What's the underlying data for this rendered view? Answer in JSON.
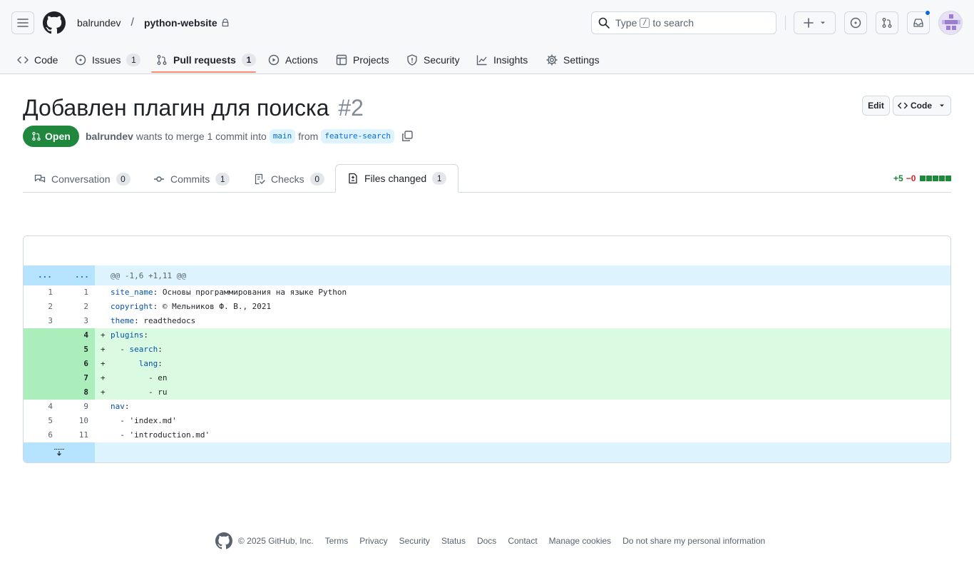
{
  "header": {
    "owner": "balrundev",
    "separator": "/",
    "repo": "python-website",
    "search": {
      "prefix": "Type",
      "key": "/",
      "suffix": "to search"
    }
  },
  "repo_nav": [
    {
      "label": "Code",
      "icon": "code-icon"
    },
    {
      "label": "Issues",
      "icon": "issue-opened-icon",
      "count": "1"
    },
    {
      "label": "Pull requests",
      "icon": "git-pull-request-icon",
      "count": "1",
      "active": true
    },
    {
      "label": "Actions",
      "icon": "play-icon"
    },
    {
      "label": "Projects",
      "icon": "table-icon"
    },
    {
      "label": "Security",
      "icon": "shield-icon"
    },
    {
      "label": "Insights",
      "icon": "graph-icon"
    },
    {
      "label": "Settings",
      "icon": "gear-icon"
    }
  ],
  "pr": {
    "title": "Добавлен плагин для поиска",
    "number": "#2",
    "state": "Open",
    "author": "balrundev",
    "merge_text": "wants to merge 1 commit into",
    "base": "main",
    "from_text": "from",
    "head": "feature-search",
    "edit_label": "Edit",
    "code_label": "Code"
  },
  "tabs": [
    {
      "label": "Conversation",
      "count": "0",
      "icon": "comment-discussion-icon"
    },
    {
      "label": "Commits",
      "count": "1",
      "icon": "git-commit-icon"
    },
    {
      "label": "Checks",
      "count": "0",
      "icon": "checklist-icon"
    },
    {
      "label": "Files changed",
      "count": "1",
      "icon": "file-diff-icon",
      "active": true
    }
  ],
  "diffstat": {
    "additions": "+5",
    "deletions": "−0",
    "blocks": 5
  },
  "diff": {
    "hunk_expander_left": "...",
    "hunk_expander_right": "...",
    "hunk_header": "@@ -1,6 +1,11 @@",
    "lines": [
      {
        "old": "1",
        "new": "1",
        "type": "ctx",
        "key": "site_name",
        "rest": ": Основы программирования на языке Python"
      },
      {
        "old": "2",
        "new": "2",
        "type": "ctx",
        "key": "copyright",
        "rest": ": © Мельников Ф. В., 2021"
      },
      {
        "old": "3",
        "new": "3",
        "type": "ctx",
        "key": "theme",
        "rest": ": readthedocs"
      },
      {
        "old": "",
        "new": "4",
        "type": "add",
        "indent": "",
        "key": "plugins",
        "rest": ":"
      },
      {
        "old": "",
        "new": "5",
        "type": "add",
        "indent": "  - ",
        "key": "search",
        "rest": ":"
      },
      {
        "old": "",
        "new": "6",
        "type": "add",
        "indent": "      ",
        "key": "lang",
        "rest": ":"
      },
      {
        "old": "",
        "new": "7",
        "type": "add",
        "indent": "        - ",
        "key": "",
        "rest": "en"
      },
      {
        "old": "",
        "new": "8",
        "type": "add",
        "indent": "        - ",
        "key": "",
        "rest": "ru"
      },
      {
        "old": "4",
        "new": "9",
        "type": "ctx",
        "key": "nav",
        "rest": ":"
      },
      {
        "old": "5",
        "new": "10",
        "type": "ctx",
        "indent": "  - ",
        "key": "",
        "rest": "'index.md'"
      },
      {
        "old": "6",
        "new": "11",
        "type": "ctx",
        "indent": "  - ",
        "key": "",
        "rest": "'introduction.md'"
      }
    ]
  },
  "footer": {
    "copyright": "© 2025 GitHub, Inc.",
    "links": [
      "Terms",
      "Privacy",
      "Security",
      "Status",
      "Docs",
      "Contact",
      "Manage cookies",
      "Do not share my personal information"
    ]
  },
  "colors": {
    "open_green": "#1f883d",
    "accent_blue": "#0969da",
    "tab_underline": "#fd8c73",
    "add_bg": "#dafbe1",
    "add_gutter": "#aceebb",
    "hunk_bg": "#ddf4ff"
  }
}
